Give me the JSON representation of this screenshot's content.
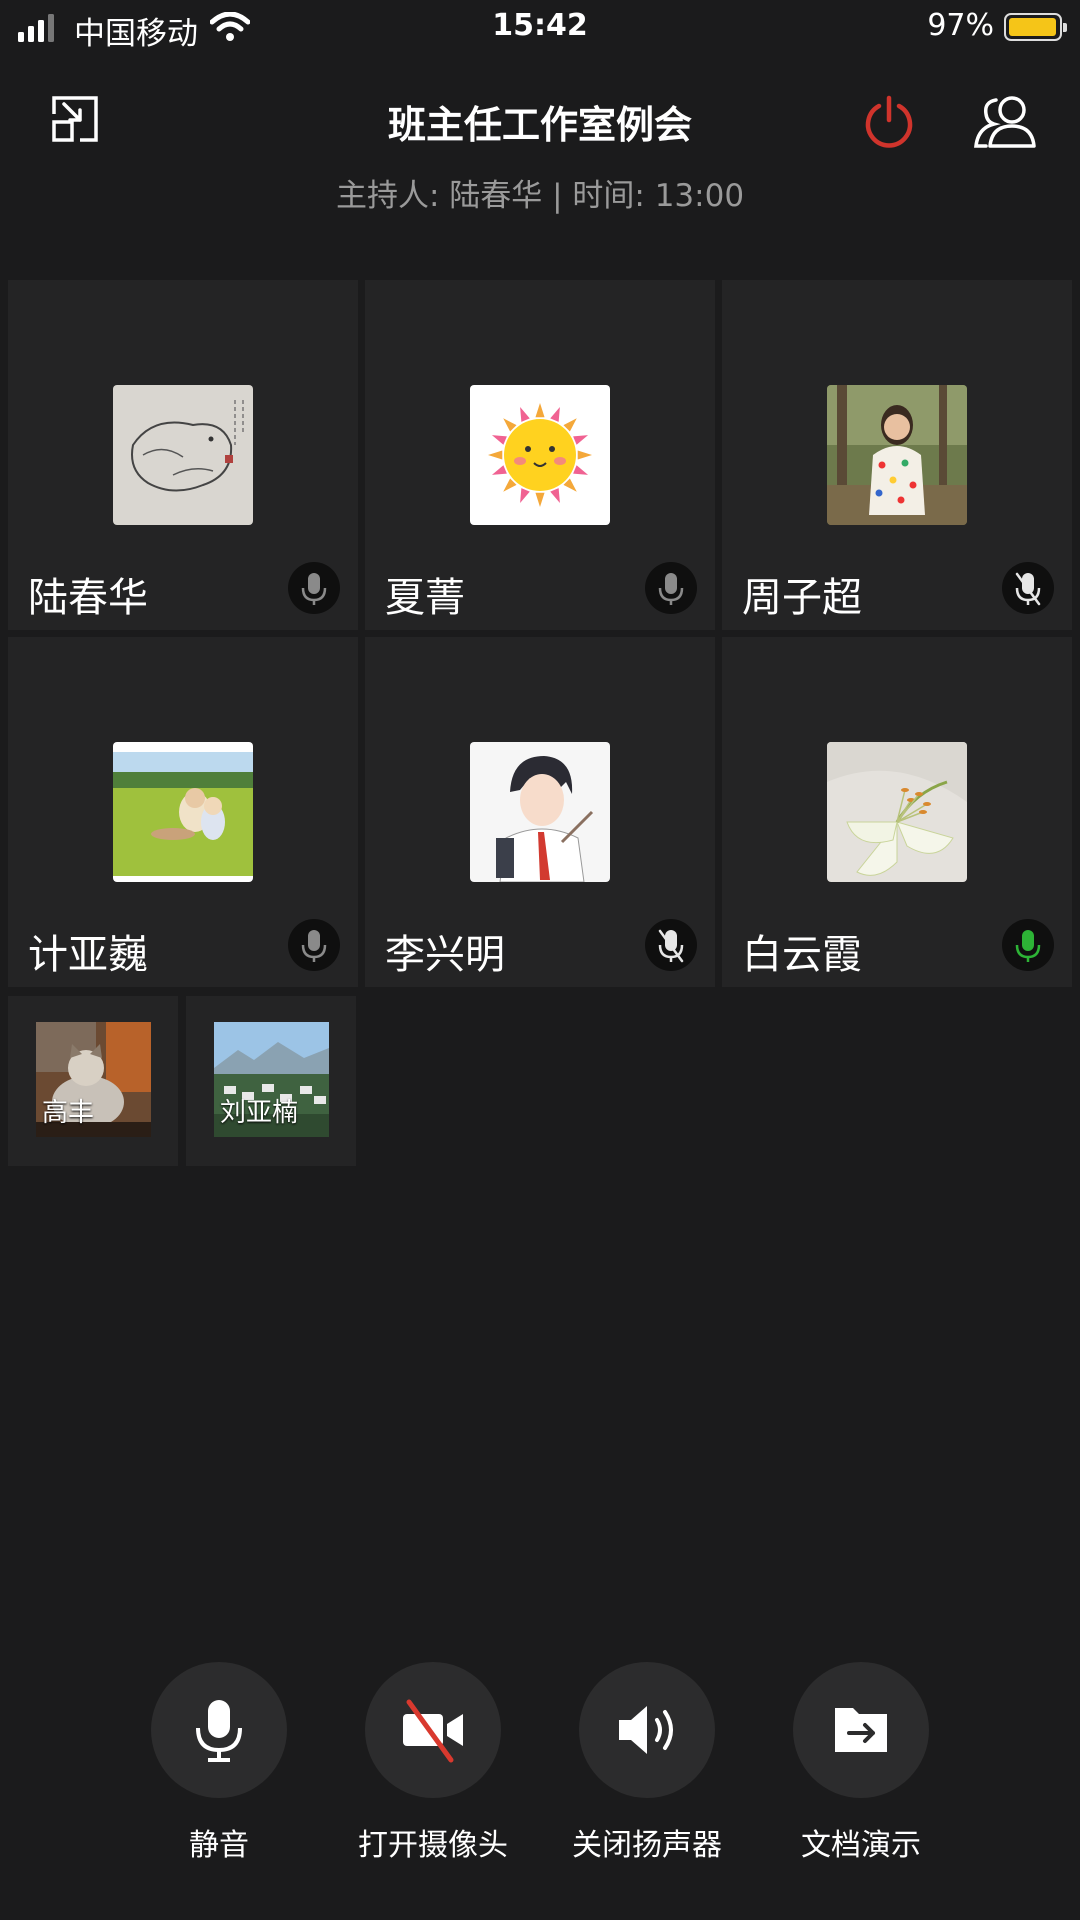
{
  "status_bar": {
    "carrier": "中国移动",
    "time": "15:42",
    "battery": "97%",
    "battery_level": 0.97,
    "battery_color": "#f5c518"
  },
  "header": {
    "title": "班主任工作室例会",
    "subtitle": "主持人: 陆春华 | 时间: 13:00",
    "icons": [
      "minimize-window-icon",
      "power-icon",
      "members-icon"
    ],
    "power_color": "#d0342c"
  },
  "participants": [
    {
      "name": "陆春华",
      "mic": "on",
      "avatar": "sketch-drawing"
    },
    {
      "name": "夏菁",
      "mic": "on",
      "avatar": "sun-cartoon"
    },
    {
      "name": "周子超",
      "mic": "muted",
      "avatar": "girl-photo"
    },
    {
      "name": "计亚巍",
      "mic": "on",
      "avatar": "kids-on-grass"
    },
    {
      "name": "李兴明",
      "mic": "muted",
      "avatar": "anime-boy"
    },
    {
      "name": "白云霞",
      "mic": "speaking",
      "avatar": "white-lily"
    }
  ],
  "small_participants": [
    {
      "name": "高丰",
      "avatar": "cat-photo"
    },
    {
      "name": "刘亚楠",
      "avatar": "mountain-town"
    }
  ],
  "mic_speaking_color": "#2db336",
  "controls": [
    {
      "label": "静音",
      "icon": "microphone-icon"
    },
    {
      "label": "打开摄像头",
      "icon": "camera-off-icon"
    },
    {
      "label": "关闭扬声器",
      "icon": "speaker-icon"
    },
    {
      "label": "文档演示",
      "icon": "document-share-icon"
    }
  ]
}
